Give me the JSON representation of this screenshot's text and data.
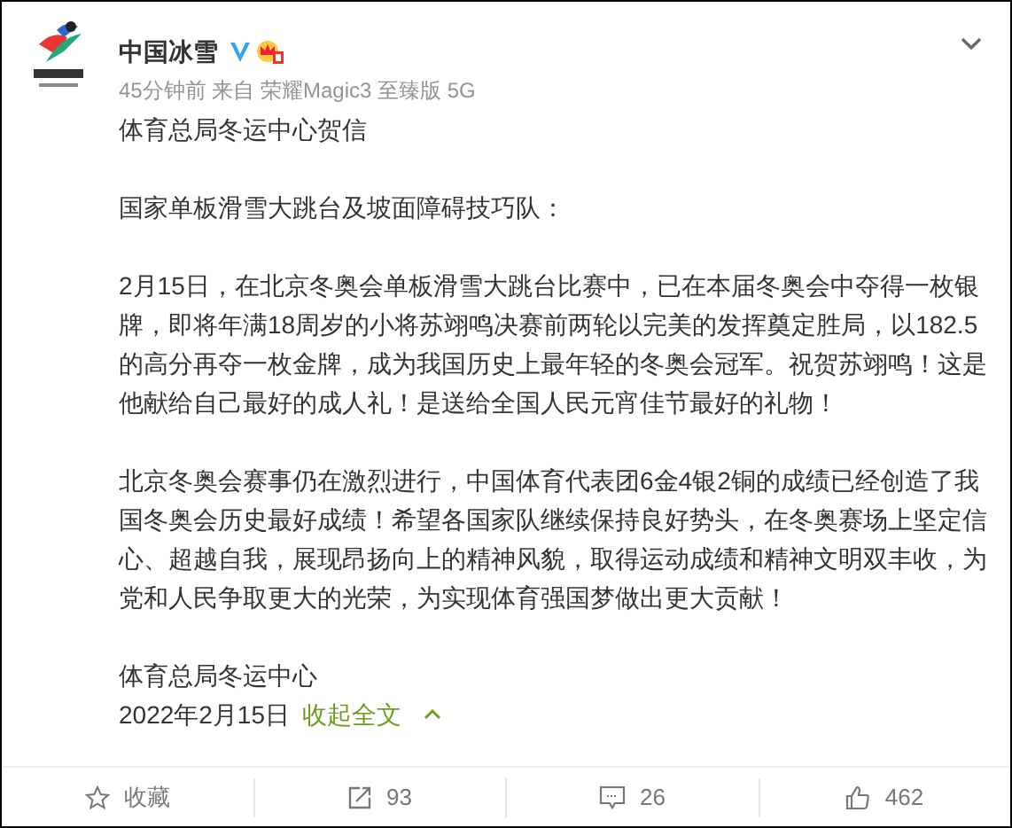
{
  "post": {
    "author": "中国冰雪",
    "verified": true,
    "member_badge": true,
    "meta": "45分钟前 来自 荣耀Magic3 至臻版 5G",
    "paragraphs": [
      "体育总局冬运中心贺信",
      "国家单板滑雪大跳台及坡面障碍技巧队：",
      "2月15日，在北京冬奥会单板滑雪大跳台比赛中，已在本届冬奥会中夺得一枚银牌，即将年满18周岁的小将苏翊鸣决赛前两轮以完美的发挥奠定胜局，以182.5的高分再夺一枚金牌，成为我国历史上最年轻的冬奥会冠军。祝贺苏翊鸣！这是他献给自己最好的成人礼！是送给全国人民元宵佳节最好的礼物！",
      "北京冬奥会赛事仍在激烈进行，中国体育代表团6金4银2铜的成绩已经创造了我国冬奥会历史最好成绩！希望各国家队继续保持良好势头，在冬奥赛场上坚定信心、超越自我，展现昂扬向上的精神风貌，取得运动成绩和精神文明双丰收，为党和人民争取更大的光荣，为实现体育强国梦做出更大贡献！",
      "体育总局冬运中心"
    ],
    "date": "2022年2月15日",
    "collapse_link": "收起全文"
  },
  "actions": [
    {
      "kind": "favorite",
      "label": "收藏"
    },
    {
      "kind": "repost",
      "label": "93"
    },
    {
      "kind": "comment",
      "label": "26"
    },
    {
      "kind": "like",
      "label": "462"
    }
  ]
}
